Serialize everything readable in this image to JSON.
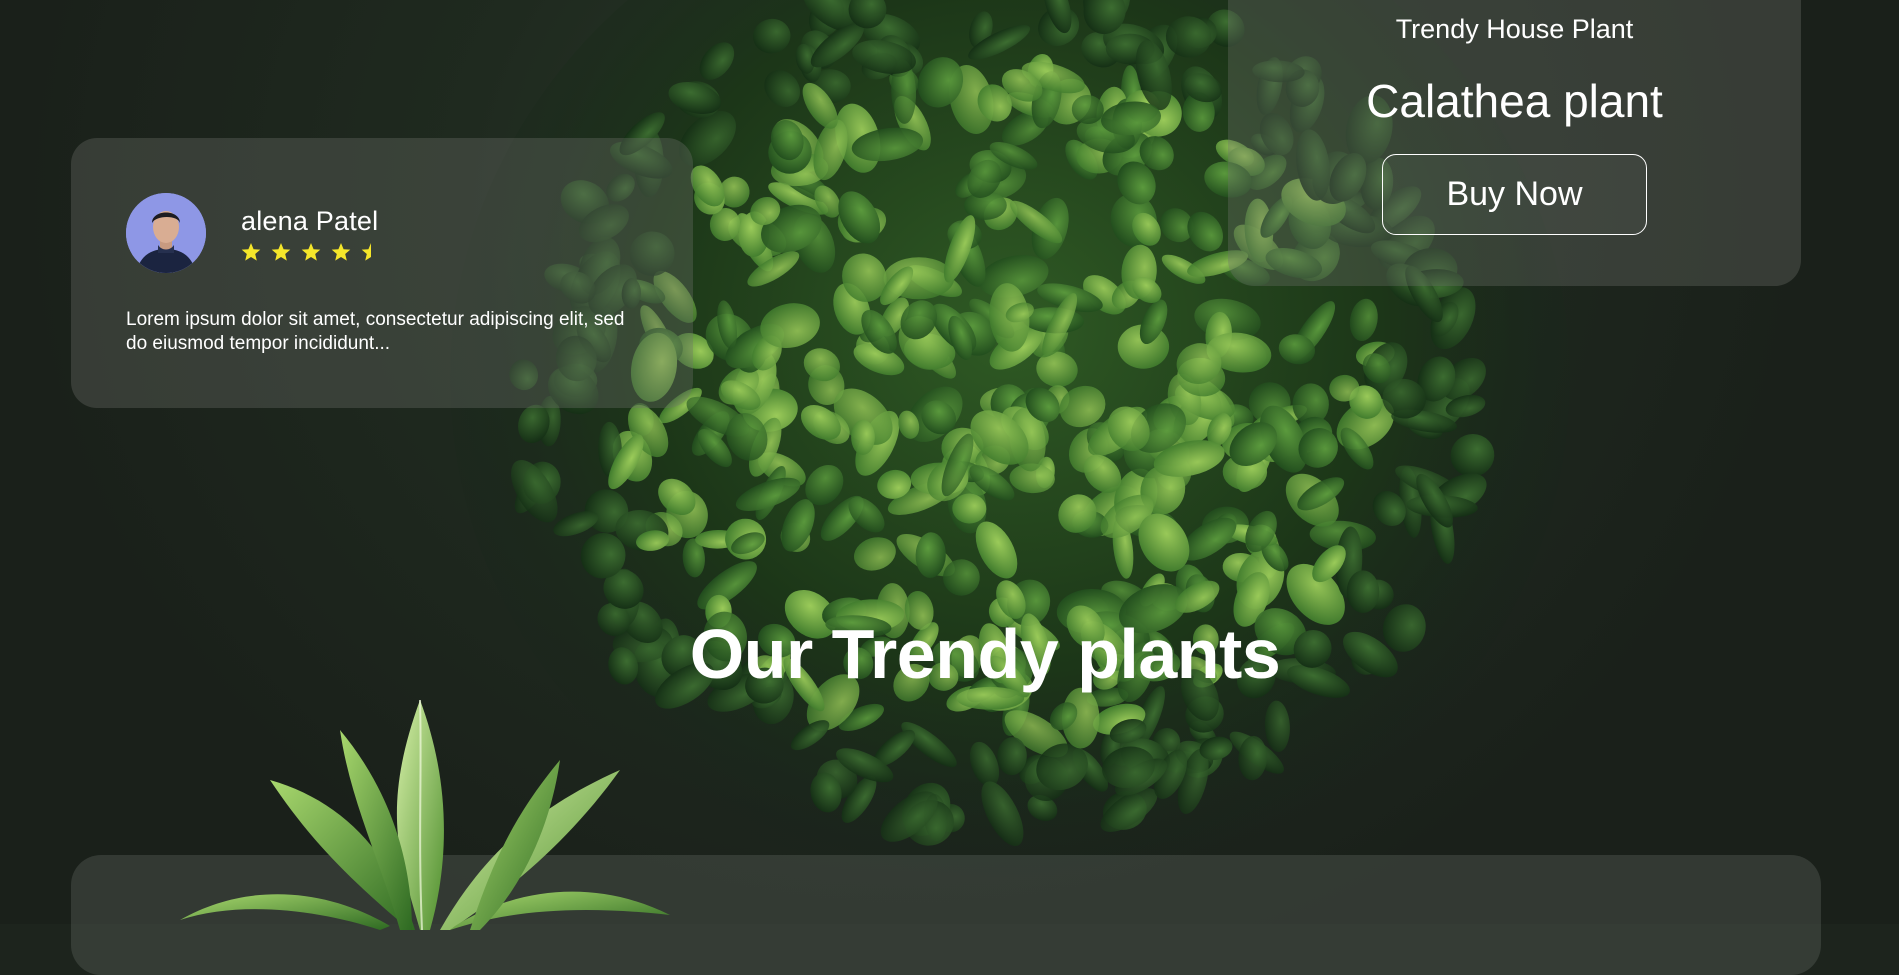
{
  "review": {
    "name": "alena Patel",
    "rating": 4.5,
    "rating_max": 5,
    "text": "Lorem ipsum dolor sit amet, consectetur adipiscing elit, sed do eiusmod tempor incididunt..."
  },
  "product": {
    "kicker": "Trendy House Plant",
    "name": "Calathea plant",
    "buy_label": "Buy Now"
  },
  "section": {
    "title": "Our Trendy plants"
  },
  "colors": {
    "star": "#f5e62a",
    "card": "#6e736c",
    "background": "#1d241d",
    "leaf": "#3f7a33"
  }
}
